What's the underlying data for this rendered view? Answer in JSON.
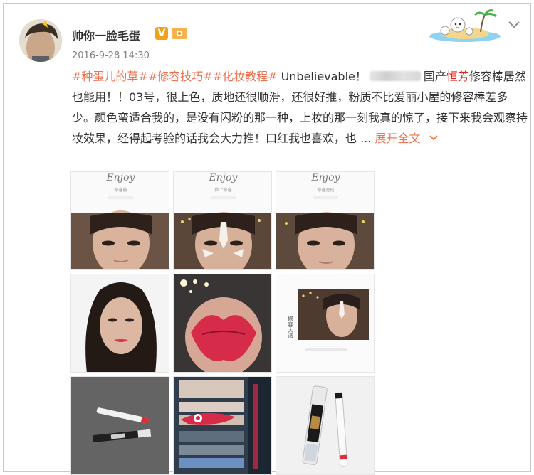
{
  "post": {
    "username": "帅你一脸毛蛋",
    "verified_badge": "V",
    "timestamp": "2016-9-28 14:30",
    "text_parts": {
      "tag1": "#种蛋儿的草#",
      "tag2": "#修容技巧#",
      "tag3": "#化妆教程#",
      "t1": " Unbelievable！",
      "t2": "国产",
      "highlight": "恒芳",
      "t3": "修容棒居然也能用！！03号，很上色，质地还很顺滑，还很好推，粉质不比爱丽小屋的修容棒差多少。颜色蛮适合我的，是没有闪粉的那一种，上妆的那一刻我真的惊了，接下来我会观察持妆效果，经得起考验的话我会大力推！口红我也喜欢，也 ...",
      "expand": "展开全文"
    }
  },
  "images": {
    "logo_text": "Enjoy",
    "panel1_caption": "修容前",
    "panel2_caption": "脸上修容",
    "panel3_caption": "修容完成",
    "side_caption": "修容大法"
  },
  "colors": {
    "tag": "#eb7350",
    "highlight": "#e2231a",
    "text": "#333333",
    "timestamp": "#808080"
  },
  "icons": [
    "avatar",
    "verified-v-icon",
    "member-level-icon",
    "island-decoration",
    "chevron-down-icon",
    "expand-chevron-icon"
  ]
}
